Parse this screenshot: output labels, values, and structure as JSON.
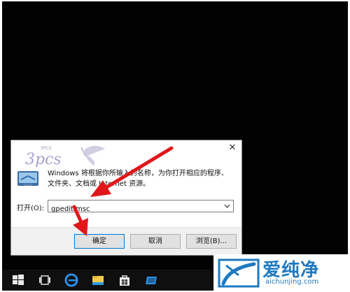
{
  "run_dialog": {
    "description_line1": "Windows 将根据你所输入的名称，为你打开相应的程序、",
    "description_line2": "文件夹、文档或 Internet 资源。",
    "open_label": "打开(O):",
    "command_value": "gpedit.msc",
    "ok_label": "确定",
    "cancel_label": "取消",
    "browse_label": "浏览(B)..."
  },
  "logo": {
    "brand": "爱纯净",
    "domain": "aichunjing.com"
  },
  "colors": {
    "arrow_red": "#e0161b",
    "brand_blue": "#1e7ac0"
  },
  "taskbar": {
    "icons": [
      "start-icon",
      "task-view-icon",
      "edge-icon",
      "file-explorer-icon",
      "store-icon",
      "mail-icon"
    ]
  }
}
